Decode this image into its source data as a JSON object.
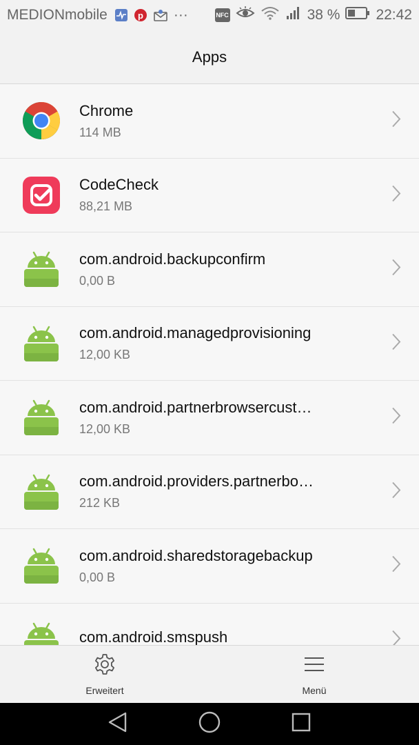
{
  "status_bar": {
    "carrier": "MEDIONmobile",
    "icons": [
      "health-icon",
      "pinterest-icon",
      "mail-icon",
      "more-dots-icon",
      "nfc-icon",
      "eye-icon",
      "wifi-icon",
      "signal-icon",
      "battery-icon"
    ],
    "nfc_label": "NFC",
    "battery_percent": "38 %",
    "time": "22:42",
    "more": "···"
  },
  "header": {
    "title": "Apps"
  },
  "apps": [
    {
      "name": "Chrome",
      "size": "114 MB",
      "icon": "chrome-icon"
    },
    {
      "name": "CodeCheck",
      "size": "88,21 MB",
      "icon": "codecheck-icon"
    },
    {
      "name": "com.android.backupconfirm",
      "size": "0,00 B",
      "icon": "android-icon"
    },
    {
      "name": "com.android.managedprovisioning",
      "size": "12,00 KB",
      "icon": "android-icon"
    },
    {
      "name": "com.android.partnerbrowsercust…",
      "size": "12,00 KB",
      "icon": "android-icon"
    },
    {
      "name": "com.android.providers.partnerbo…",
      "size": "212 KB",
      "icon": "android-icon"
    },
    {
      "name": "com.android.sharedstoragebackup",
      "size": "0,00 B",
      "icon": "android-icon"
    },
    {
      "name": "com.android.smspush",
      "size": "",
      "icon": "android-icon"
    }
  ],
  "bottom_bar": {
    "erweitert_label": "Erweitert",
    "menu_label": "Menü"
  },
  "nav_bar": {
    "icons": [
      "back-icon",
      "home-icon",
      "recents-icon"
    ]
  },
  "colors": {
    "android_green": "#8bc34a",
    "codecheck_red": "#ef3b5a",
    "background": "#f7f7f7"
  }
}
